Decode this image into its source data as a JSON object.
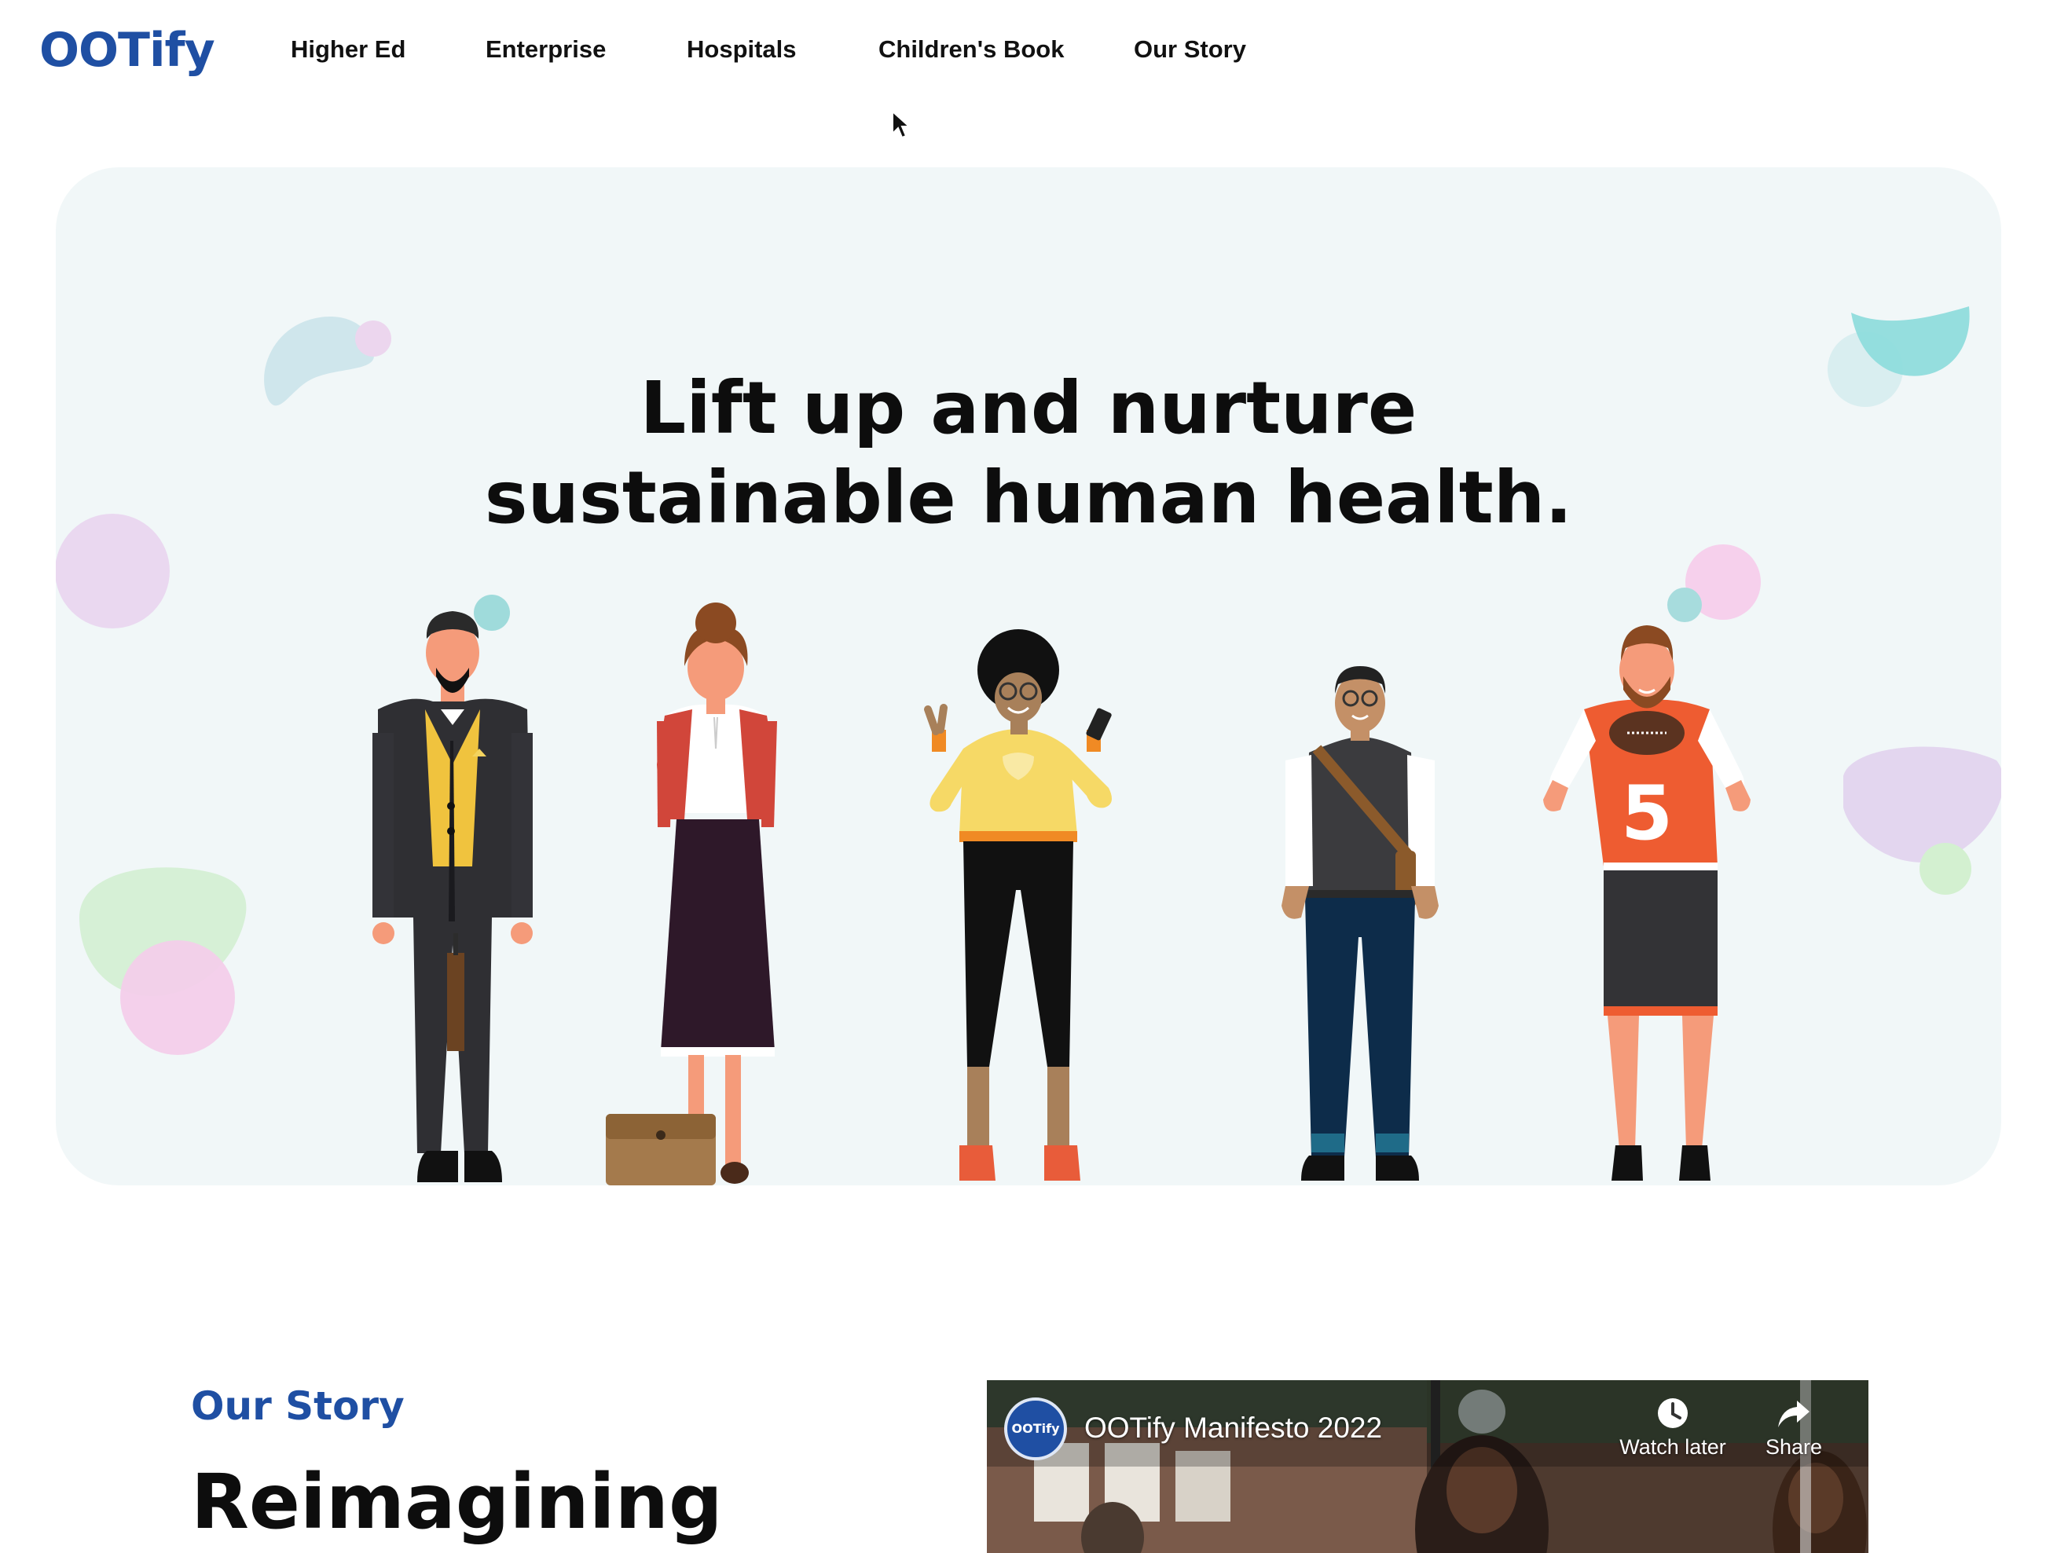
{
  "brand": {
    "logo_text": "OOTify",
    "color": "#1f4fa3"
  },
  "nav": {
    "items": [
      {
        "label": "Higher Ed"
      },
      {
        "label": "Enterprise"
      },
      {
        "label": "Hospitals"
      },
      {
        "label": "Children's Book"
      },
      {
        "label": "Our Story"
      }
    ]
  },
  "hero": {
    "title_line1": "Lift up and nurture",
    "title_line2": "sustainable human health.",
    "background": "#f1f7f8"
  },
  "story": {
    "eyebrow": "Our Story",
    "heading": "Reimagining"
  },
  "video": {
    "channel_logo_text": "OOTify",
    "title": "OOTify Manifesto 2022",
    "actions": [
      {
        "label": "Watch later",
        "icon": "clock-icon"
      },
      {
        "label": "Share",
        "icon": "share-arrow-icon"
      }
    ]
  },
  "illustration": {
    "figures": [
      "businessman",
      "woman-with-cardigan",
      "student-with-phone",
      "man-with-messenger-bag",
      "football-player"
    ],
    "jersey_number": "5"
  }
}
